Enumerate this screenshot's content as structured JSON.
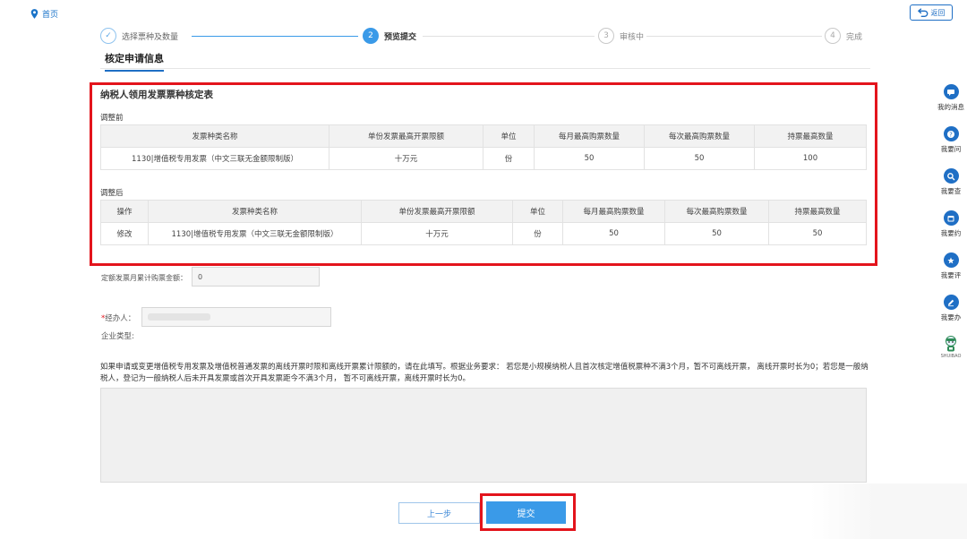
{
  "nav": {
    "home_label": "首页",
    "back_label": "返回"
  },
  "steps": [
    {
      "index": "✓",
      "label": "选择票种及数量",
      "state": "done"
    },
    {
      "index": "2",
      "label": "预览提交",
      "state": "active"
    },
    {
      "index": "3",
      "label": "审核中",
      "state": "todo"
    },
    {
      "index": "4",
      "label": "完成",
      "state": "todo"
    }
  ],
  "section_tab": "核定申请信息",
  "table_title": "纳税人领用发票票种核定表",
  "before": {
    "label": "调整前",
    "headers": [
      "发票种类名称",
      "单份发票最高开票限额",
      "单位",
      "每月最高购票数量",
      "每次最高购票数量",
      "持票最高数量"
    ],
    "rows": [
      [
        "1130|增值税专用发票（中文三联无金额限制版）",
        "十万元",
        "份",
        "50",
        "50",
        "100"
      ]
    ]
  },
  "after": {
    "label": "调整后",
    "headers": [
      "操作",
      "发票种类名称",
      "单份发票最高开票限额",
      "单位",
      "每月最高购票数量",
      "每次最高购票数量",
      "持票最高数量"
    ],
    "rows": [
      [
        "修改",
        "1130|增值税专用发票（中文三联无金额限制版）",
        "十万元",
        "份",
        "50",
        "50",
        "50"
      ]
    ]
  },
  "form": {
    "quota_label": "定额发票月累计购票金额：",
    "quota_value": "0",
    "agent_required_mark": "*",
    "agent_label": "经办人：",
    "company_type_label": "企业类型:"
  },
  "notice": "如果申请或变更增值税专用发票及增值税普通发票的离线开票时限和离线开票累计限额的，请在此填写。根据业务要求： 若您是小规模纳税人且首次核定增值税票种不满3个月，暂不可离线开票， 离线开票时长为0；若您是一般纳税人，登记为一般纳税人后未开具发票或首次开具发票距今不满3个月， 暂不可离线开票，离线开票时长为0。",
  "buttons": {
    "prev": "上一步",
    "submit": "提交"
  },
  "sidebar": [
    {
      "label": "我的消息",
      "icon": "message-icon"
    },
    {
      "label": "我要问",
      "icon": "question-icon"
    },
    {
      "label": "我要查",
      "icon": "search-icon"
    },
    {
      "label": "我要约",
      "icon": "calendar-icon"
    },
    {
      "label": "我要评",
      "icon": "rating-icon"
    },
    {
      "label": "我要办",
      "icon": "edit-icon"
    },
    {
      "label": "",
      "icon": "assistant-robot-icon",
      "mini": "SHUIBAO"
    }
  ],
  "colors": {
    "primary": "#3a9ae8",
    "highlight": "#e3141c",
    "link": "#1f6fc5"
  }
}
